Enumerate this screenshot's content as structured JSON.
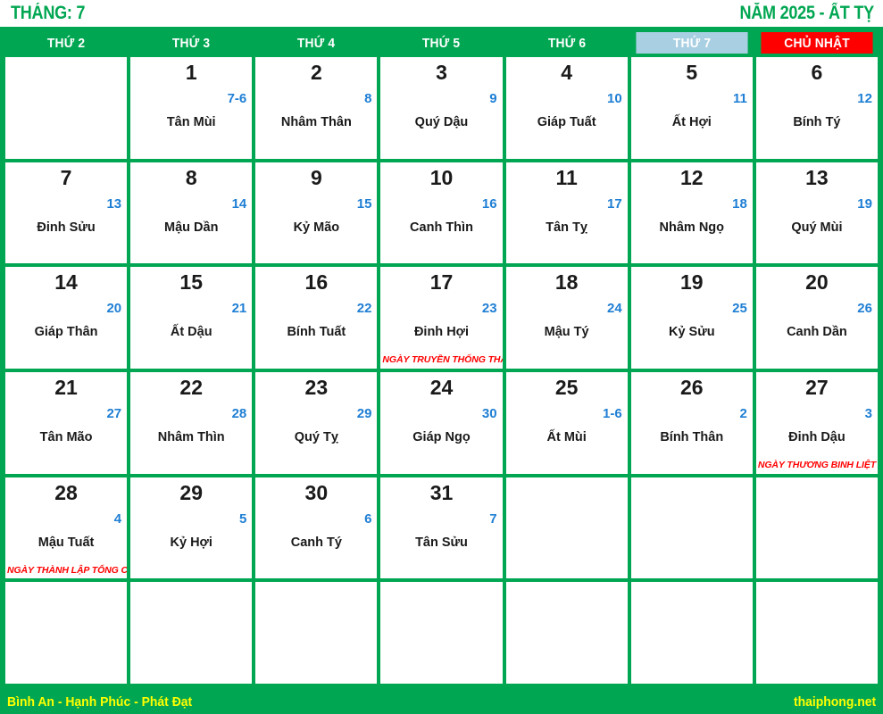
{
  "header": {
    "month_label": "THÁNG: 7",
    "year_label": "NĂM 2025 - ẤT TỴ"
  },
  "weekdays": [
    {
      "label": "THỨ 2",
      "kind": "weekday"
    },
    {
      "label": "THỨ 3",
      "kind": "weekday"
    },
    {
      "label": "THỨ 4",
      "kind": "weekday"
    },
    {
      "label": "THỨ 5",
      "kind": "weekday"
    },
    {
      "label": "THỨ 6",
      "kind": "weekday"
    },
    {
      "label": "THỨ 7",
      "kind": "saturday"
    },
    {
      "label": "CHỦ NHẬT",
      "kind": "sunday"
    }
  ],
  "colors": {
    "green": "#00a651",
    "saturday_bg": "#a9cfe2",
    "sunday_bg": "#ff0000",
    "lunar_blue": "#1f7fd4",
    "event_red": "#ff0000",
    "footer_text": "#ffff00"
  },
  "weeks": [
    [
      {
        "solar": "",
        "lunar": "",
        "canchi": "",
        "event": ""
      },
      {
        "solar": "1",
        "lunar": "7-6",
        "canchi": "Tân Mùi",
        "event": ""
      },
      {
        "solar": "2",
        "lunar": "8",
        "canchi": "Nhâm Thân",
        "event": ""
      },
      {
        "solar": "3",
        "lunar": "9",
        "canchi": "Quý Dậu",
        "event": ""
      },
      {
        "solar": "4",
        "lunar": "10",
        "canchi": "Giáp Tuất",
        "event": ""
      },
      {
        "solar": "5",
        "lunar": "11",
        "canchi": "Ất Hợi",
        "event": ""
      },
      {
        "solar": "6",
        "lunar": "12",
        "canchi": "Bính Tý",
        "event": ""
      }
    ],
    [
      {
        "solar": "7",
        "lunar": "13",
        "canchi": "Đinh Sửu",
        "event": ""
      },
      {
        "solar": "8",
        "lunar": "14",
        "canchi": "Mậu Dần",
        "event": ""
      },
      {
        "solar": "9",
        "lunar": "15",
        "canchi": "Kỷ Mão",
        "event": ""
      },
      {
        "solar": "10",
        "lunar": "16",
        "canchi": "Canh Thìn",
        "event": ""
      },
      {
        "solar": "11",
        "lunar": "17",
        "canchi": "Tân Tỵ",
        "event": ""
      },
      {
        "solar": "12",
        "lunar": "18",
        "canchi": "Nhâm Ngọ",
        "event": ""
      },
      {
        "solar": "13",
        "lunar": "19",
        "canchi": "Quý Mùi",
        "event": ""
      }
    ],
    [
      {
        "solar": "14",
        "lunar": "20",
        "canchi": "Giáp Thân",
        "event": ""
      },
      {
        "solar": "15",
        "lunar": "21",
        "canchi": "Ất Dậu",
        "event": ""
      },
      {
        "solar": "16",
        "lunar": "22",
        "canchi": "Bính Tuất",
        "event": ""
      },
      {
        "solar": "17",
        "lunar": "23",
        "canchi": "Đinh Hợi",
        "event": "NGÀY TRUYỀN THỐNG THANH NIÊN"
      },
      {
        "solar": "18",
        "lunar": "24",
        "canchi": "Mậu Tý",
        "event": ""
      },
      {
        "solar": "19",
        "lunar": "25",
        "canchi": "Kỷ Sửu",
        "event": ""
      },
      {
        "solar": "20",
        "lunar": "26",
        "canchi": "Canh Dần",
        "event": ""
      }
    ],
    [
      {
        "solar": "21",
        "lunar": "27",
        "canchi": "Tân Mão",
        "event": ""
      },
      {
        "solar": "22",
        "lunar": "28",
        "canchi": "Nhâm Thìn",
        "event": ""
      },
      {
        "solar": "23",
        "lunar": "29",
        "canchi": "Quý Tỵ",
        "event": ""
      },
      {
        "solar": "24",
        "lunar": "30",
        "canchi": "Giáp Ngọ",
        "event": ""
      },
      {
        "solar": "25",
        "lunar": "1-6",
        "canchi": "Ất Mùi",
        "event": ""
      },
      {
        "solar": "26",
        "lunar": "2",
        "canchi": "Bính Thân",
        "event": ""
      },
      {
        "solar": "27",
        "lunar": "3",
        "canchi": "Đinh Dậu",
        "event": "NGÀY THƯƠNG BINH LIỆT SĨ"
      }
    ],
    [
      {
        "solar": "28",
        "lunar": "4",
        "canchi": "Mậu Tuất",
        "event": "NGÀY THÀNH LẬP TỔNG CỤC"
      },
      {
        "solar": "29",
        "lunar": "5",
        "canchi": "Kỷ Hợi",
        "event": ""
      },
      {
        "solar": "30",
        "lunar": "6",
        "canchi": "Canh Tý",
        "event": ""
      },
      {
        "solar": "31",
        "lunar": "7",
        "canchi": "Tân Sửu",
        "event": ""
      },
      {
        "solar": "",
        "lunar": "",
        "canchi": "",
        "event": ""
      },
      {
        "solar": "",
        "lunar": "",
        "canchi": "",
        "event": ""
      },
      {
        "solar": "",
        "lunar": "",
        "canchi": "",
        "event": ""
      }
    ],
    [
      {
        "solar": "",
        "lunar": "",
        "canchi": "",
        "event": ""
      },
      {
        "solar": "",
        "lunar": "",
        "canchi": "",
        "event": ""
      },
      {
        "solar": "",
        "lunar": "",
        "canchi": "",
        "event": ""
      },
      {
        "solar": "",
        "lunar": "",
        "canchi": "",
        "event": ""
      },
      {
        "solar": "",
        "lunar": "",
        "canchi": "",
        "event": ""
      },
      {
        "solar": "",
        "lunar": "",
        "canchi": "",
        "event": ""
      },
      {
        "solar": "",
        "lunar": "",
        "canchi": "",
        "event": ""
      }
    ]
  ],
  "footer": {
    "slogan": "Bình An - Hạnh Phúc - Phát Đạt",
    "site": "thaiphong.net"
  }
}
